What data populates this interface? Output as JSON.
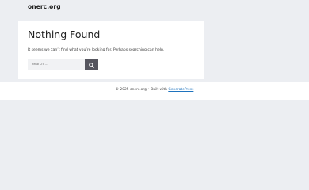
{
  "site": {
    "title": "onerc.org"
  },
  "main": {
    "title": "Nothing Found",
    "message": "It seems we can’t find what you’re looking for. Perhaps searching can help."
  },
  "search": {
    "placeholder": "Search ...",
    "value": "",
    "button_icon": "search-icon"
  },
  "footer": {
    "copyright": "© 2025 onerc.org • Built with",
    "link_label": "GeneratePress"
  },
  "colors": {
    "background": "#eceef2",
    "card": "#ffffff",
    "button": "#55555e",
    "link": "#1e73be"
  }
}
